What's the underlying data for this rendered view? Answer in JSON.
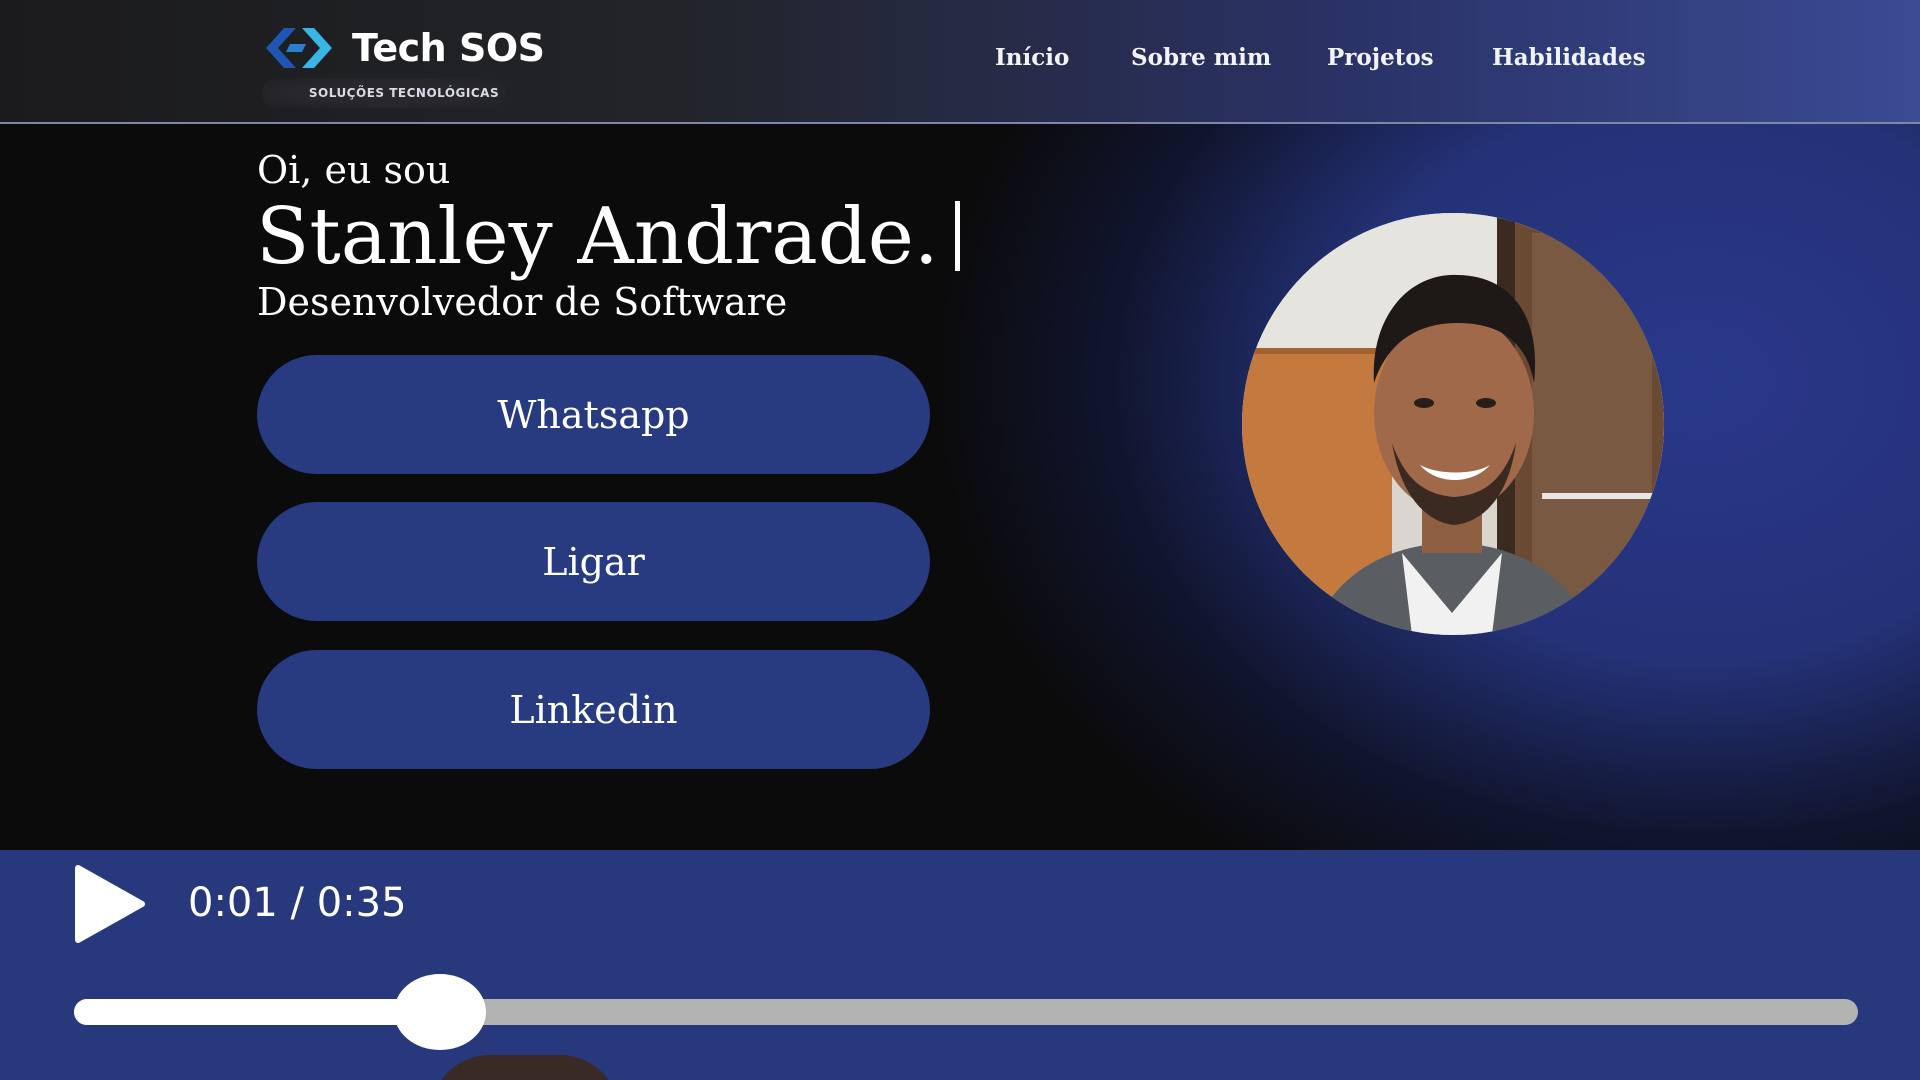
{
  "header": {
    "logo": {
      "name": "Tech SOS",
      "tagline": "SOLUÇÕES TECNOLÓGICAS",
      "icon": "code-brackets-icon"
    },
    "nav": [
      {
        "label": "Início"
      },
      {
        "label": "Sobre mim"
      },
      {
        "label": "Projetos"
      },
      {
        "label": "Habilidades"
      }
    ]
  },
  "hero": {
    "greeting": "Oi, eu sou",
    "name": "Stanley Andrade.",
    "role": "Desenvolvedor de Software",
    "buttons": [
      {
        "label": "Whatsapp"
      },
      {
        "label": "Ligar"
      },
      {
        "label": "Linkedin"
      }
    ],
    "avatar": "profile-photo"
  },
  "player": {
    "time": "0:01 / 0:35",
    "progress": 0.205,
    "play_icon": "play-icon"
  },
  "colors": {
    "accent_blue": "#283a80",
    "player_bar": "#27387d",
    "logo_dark_blue": "#1f56b3",
    "logo_light_blue": "#38b6e6"
  }
}
